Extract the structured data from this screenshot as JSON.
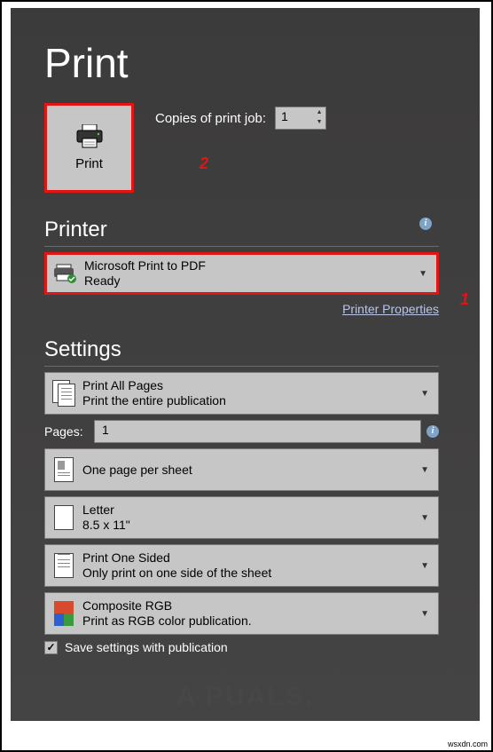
{
  "title": "Print",
  "print_button": {
    "label": "Print"
  },
  "copies": {
    "label": "Copies of print job:",
    "value": "1"
  },
  "annotation_1": "1",
  "annotation_2": "2",
  "printer_section": {
    "header": "Printer",
    "selected": {
      "name": "Microsoft Print to PDF",
      "status": "Ready"
    },
    "link": "Printer Properties"
  },
  "settings_section": {
    "header": "Settings",
    "print_range": {
      "title": "Print All Pages",
      "sub": "Print the entire publication"
    },
    "pages": {
      "label": "Pages:",
      "value": "1"
    },
    "layout": {
      "title": "One page per sheet"
    },
    "paper": {
      "title": "Letter",
      "sub": "8.5 x 11\""
    },
    "duplex": {
      "title": "Print One Sided",
      "sub": "Only print on one side of the sheet"
    },
    "color": {
      "title": "Composite RGB",
      "sub": "Print as RGB color publication."
    },
    "save_checkbox": {
      "label": "Save settings with publication",
      "checked": true
    }
  },
  "watermark": "A  PUALS.",
  "credit": "wsxdn.com"
}
